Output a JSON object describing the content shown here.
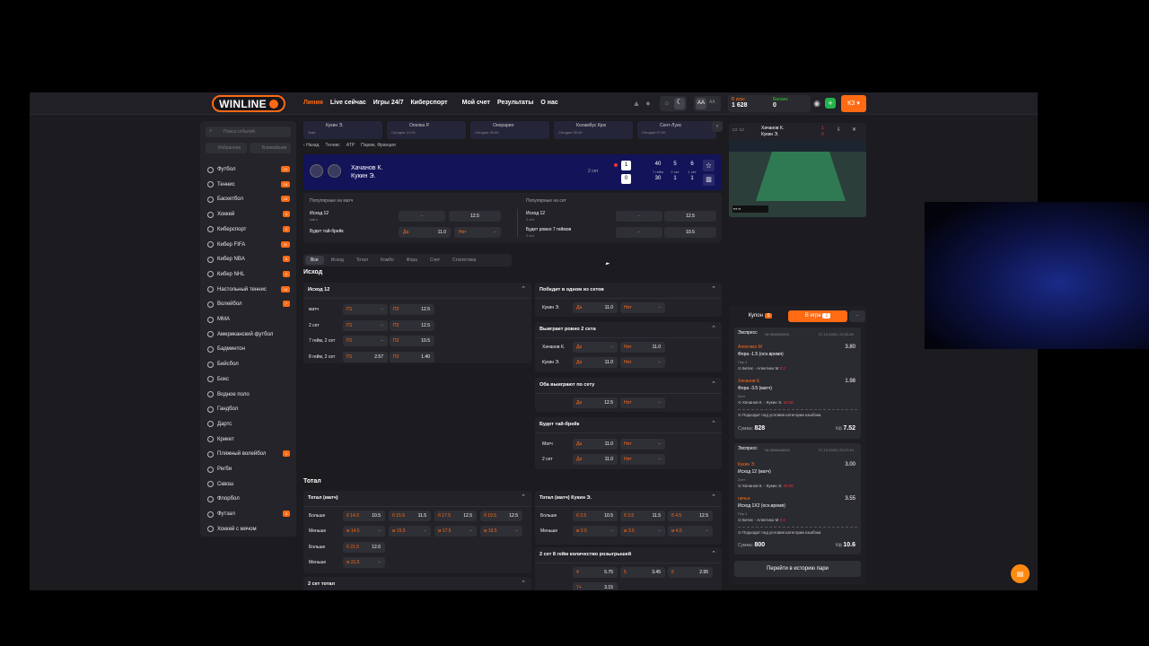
{
  "header": {
    "logo": "WINLINE",
    "nav": [
      "Линия",
      "Live сейчас",
      "Игры 24/7",
      "Киберспорт",
      "Мой счет",
      "Результаты",
      "О нас"
    ],
    "ingame_label": "В игре",
    "ingame_value": "1 628",
    "balance_label": "Баланс",
    "balance_value": "0",
    "currency": "КЗ"
  },
  "sidebar": {
    "search_placeholder": "Поиск событий",
    "btn_favorites": "Избранное",
    "btn_live": "Ближайшие",
    "items": [
      {
        "label": "Футбол",
        "count": "10"
      },
      {
        "label": "Теннис",
        "count": "18"
      },
      {
        "label": "Баскетбол",
        "count": "15"
      },
      {
        "label": "Хоккей",
        "count": "3"
      },
      {
        "label": "Киберспорт",
        "count": "2"
      },
      {
        "label": "Кибер FIFA",
        "count": "11"
      },
      {
        "label": "Кибер NBA",
        "count": "6"
      },
      {
        "label": "Кибер NHL",
        "count": "2"
      },
      {
        "label": "Настольный теннис",
        "count": "16"
      },
      {
        "label": "Волейбол",
        "count": "7"
      },
      {
        "label": "ММА",
        "count": ""
      },
      {
        "label": "Американский футбол",
        "count": ""
      },
      {
        "label": "Бадминтон",
        "count": ""
      },
      {
        "label": "Бейсбол",
        "count": ""
      },
      {
        "label": "Бокс",
        "count": ""
      },
      {
        "label": "Водное поло",
        "count": ""
      },
      {
        "label": "Гандбол",
        "count": ""
      },
      {
        "label": "Дартс",
        "count": ""
      },
      {
        "label": "Крикет",
        "count": ""
      },
      {
        "label": "Пляжный волейбол",
        "count": "1"
      },
      {
        "label": "Регби",
        "count": ""
      },
      {
        "label": "Сквош",
        "count": ""
      },
      {
        "label": "Флорбол",
        "count": ""
      },
      {
        "label": "Футзал",
        "count": "3"
      },
      {
        "label": "Хоккей с мячом",
        "count": ""
      }
    ]
  },
  "strip": [
    "Кукин Э.",
    "Опелка Р.",
    "Онорарио",
    "Коламбус Крю",
    "Сент-Луис"
  ],
  "strip_times": [
    "Завт",
    "Сегодня 14:10",
    "Сегодня 09:00",
    "Сегодня 05:45",
    "Сегодня 07:00"
  ],
  "breadcrumb": [
    "Назад",
    "Теннис",
    "ATP",
    "Париж, Франция"
  ],
  "match": {
    "p1": "Хачанов К.",
    "p2": "Кукин Э.",
    "set_label": "2 сет",
    "score1": "1",
    "score2": "0",
    "g_top": [
      "40",
      "5",
      "6"
    ],
    "g_bottom": [
      "30",
      "1",
      "1"
    ],
    "g_lbl": [
      "7 гейм",
      "2 сет",
      "1 сет"
    ]
  },
  "popular": {
    "match_title": "Популярные на матч",
    "set_title": "Популярные на сет",
    "m_outcome": "Исход 12",
    "m_outcome_sub": "матч",
    "m_outcome_val": "12.5",
    "m_tb": "Будет тай-брейк",
    "m_yes": "Да",
    "m_yes_val": "11.0",
    "m_no": "Нет",
    "s_outcome": "Исход 12",
    "s_outcome_sub": "2 сет",
    "s_outcome_val": "12.5",
    "s_games": "Будет ровно 7 геймов",
    "s_games_sub": "2 сет",
    "s_games_val": "10.5"
  },
  "tabs": [
    "Все",
    "Исход",
    "Тотал",
    "Комбо",
    "Фора",
    "Счет",
    "Статистика"
  ],
  "section_outcome": "Исход",
  "section_total": "Тотал",
  "m_outcome12": {
    "title": "Исход 12",
    "rows": [
      {
        "label": "матч",
        "v1": "–",
        "k2": "П2",
        "v2": "12.5"
      },
      {
        "label": "2 сет",
        "v1": "–",
        "k2": "П2",
        "v2": "12.5"
      },
      {
        "label": "7 гейм, 2 сет",
        "v1": "–",
        "k2": "П2",
        "v2": "10.5"
      },
      {
        "label": "8 гейм, 2 сет",
        "v1": "2.57",
        "k2": "П2",
        "v2": "1.40"
      }
    ],
    "k1": "П1"
  },
  "m_win_set": {
    "title": "Победит в одном из сетов",
    "row": "Кукин Э.",
    "yes": "Да",
    "yes_val": "11.0",
    "no": "Нет"
  },
  "m_exact2": {
    "title": "Выиграет ровно 2 сета",
    "r1": "Хачанов К.",
    "r2": "Кукин Э.",
    "no_val1": "11.0",
    "yes_val2": "11.0"
  },
  "m_both": {
    "title": "Оба выиграют по сету",
    "val": "12.5"
  },
  "m_tiebreak": {
    "title": "Будет тай-брейк",
    "r1": "Матч",
    "r2": "2 сет",
    "val1": "11.0",
    "val2": "11.0"
  },
  "m_total": {
    "title": "Тотал (матч)",
    "more": "Больше",
    "less": "Меньше",
    "ks": [
      "б 14.5",
      "б 15.5",
      "б 17.5",
      "б 19.5"
    ],
    "vs": [
      "10.5",
      "11.5",
      "12.5",
      "12.5"
    ],
    "ms": [
      "м 14.5",
      "м 15.5",
      "м 17.5",
      "м 19.5"
    ],
    "more2_k": "б 21.5",
    "more2_v": "12.6",
    "less2_k": "м 21.5"
  },
  "m_total_kukin": {
    "title": "Тотал (матч) Кукин Э.",
    "more": "Больше",
    "less": "Меньше",
    "ks": [
      "б 2.5",
      "б 3.5",
      "б 4.5"
    ],
    "vs": [
      "10.5",
      "11.5",
      "12.5"
    ],
    "ms": [
      "м 2.5",
      "м 3.5",
      "м 4.5"
    ]
  },
  "m_set2_total": {
    "title": "2 сет тотал"
  },
  "m_games8": {
    "title": "2 сет 8 гейм количество розыгрышей",
    "v1": "5.75",
    "v2": "3.45",
    "v3": "2.95",
    "v4": "3.15"
  },
  "coupon": {
    "tab_coupon": "Купон",
    "coupon_count": "0",
    "tab_ingame": "В игре",
    "ingame_count": "2",
    "bet1": {
      "type": "Экспресс",
      "id": "№ 3649455491",
      "date": "27.10.2025 | 22:42:49",
      "l1_team": "Алектико М",
      "l1_market": "Фора -1.5 (осн.время)",
      "l1_odd": "3.80",
      "l1_sub": "Пер.1",
      "l1_match": "Бетис - Алектико М",
      "l1_score": "0:2",
      "l2_team": "Хачанов К.",
      "l2_market": "Фора -3.5 (матч)",
      "l2_odd": "1.98",
      "l2_sub": "2сет",
      "l2_match": "Хачанов К. - Кукин Э.",
      "l2_score": "00:30",
      "cashback": "Подходит под условия категории кэшбэка",
      "sum_label": "Сумма:",
      "sum": "828",
      "kf_label": "Кф",
      "kf": "7.52"
    },
    "bet2": {
      "type": "Экспресс",
      "id": "№ 3649448243",
      "date": "27.10.2025 | 22:27:43",
      "l1_team": "Кукин Э.",
      "l1_market": "Исход 12 (матч)",
      "l1_odd": "3.00",
      "l1_sub": "2сет",
      "l1_match": "Хачанов К. - Кукин Э.",
      "l1_score": "00:30",
      "l2_team": "ничья",
      "l2_market": "Исход 1X2 (осн.время)",
      "l2_odd": "3.55",
      "l2_sub": "Пер.1",
      "l2_match": "Бетис - Алектико М",
      "l2_score": "0:2",
      "cashback": "Подходит под условия категории кэшбэка",
      "sum_label": "Сумма:",
      "sum": "800",
      "kf_label": "Кф",
      "kf": "10.6"
    },
    "history_btn": "Перейти в историю пари"
  },
  "video": {
    "p1": "Хачанов К.",
    "p2": "Кукин Э.",
    "s1": "1",
    "s2": "0"
  },
  "colors": {
    "accent": "#ff6a13",
    "bg": "#1b1b20",
    "panel": "#222228",
    "matchbar": "#13135a"
  }
}
